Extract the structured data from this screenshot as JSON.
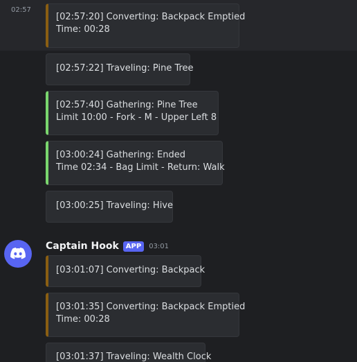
{
  "colors": {
    "background": "#1e1f22",
    "highlight_row": "#26272b",
    "embed_background": "#2b2d31",
    "bar_converting": "#8a5e12",
    "bar_gathering": "#7ad66e",
    "app_badge": "#5865f2"
  },
  "top_message": {
    "timestamp": "02:57"
  },
  "messages": [
    {
      "line1": "[02:57:20] Converting: Backpack Emptied",
      "line2": "Time: 00:28",
      "bar": "orange"
    },
    {
      "line1": "[02:57:22] Traveling: Pine Tree",
      "bar": "none"
    },
    {
      "line1": "[02:57:40] Gathering: Pine Tree",
      "line2": "Limit 10:00 - Fork - M - Upper Left 8",
      "bar": "green"
    },
    {
      "line1": "[03:00:24] Gathering: Ended",
      "line2": "Time 02:34 - Bag Limit - Return: Walk",
      "bar": "green"
    },
    {
      "line1": "[03:00:25] Traveling: Hive",
      "bar": "none"
    },
    {
      "line1": "[03:01:07] Converting: Backpack",
      "bar": "orange"
    },
    {
      "line1": "[03:01:35] Converting: Backpack Emptied",
      "line2": "Time: 00:28",
      "bar": "orange"
    },
    {
      "line1": "[03:01:37] Traveling: Wealth Clock",
      "bar": "none"
    }
  ],
  "author": {
    "name": "Captain Hook",
    "badge": "APP",
    "time": "03:01",
    "avatar_icon": "discord-logo-icon"
  }
}
